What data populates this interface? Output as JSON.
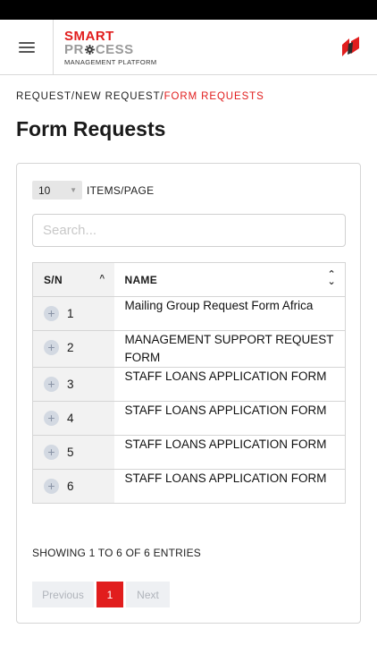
{
  "header": {
    "logo": {
      "line1": "SMART",
      "line2_part1": "PR",
      "line2_part2": "CESS",
      "line3": "MANAGEMENT PLATFORM"
    },
    "menu_icon": "hamburger-icon",
    "brand_icon": "company-logo"
  },
  "breadcrumb": {
    "part1": "REQUEST/",
    "part2": "NEW REQUEST/",
    "current": "FORM REQUESTS"
  },
  "page": {
    "title": "Form Requests"
  },
  "controls": {
    "page_size_value": "10",
    "page_size_label": "ITEMS/PAGE",
    "search_placeholder": "Search..."
  },
  "table": {
    "columns": [
      "S/N",
      "NAME"
    ],
    "rows": [
      {
        "sn": "1",
        "name": "Mailing Group Request Form Africa"
      },
      {
        "sn": "2",
        "name": "MANAGEMENT SUPPORT REQUEST FORM"
      },
      {
        "sn": "3",
        "name": "STAFF LOANS APPLICATION FORM"
      },
      {
        "sn": "4",
        "name": "STAFF LOANS APPLICATION FORM"
      },
      {
        "sn": "5",
        "name": "STAFF LOANS APPLICATION FORM"
      },
      {
        "sn": "6",
        "name": "STAFF LOANS APPLICATION FORM"
      }
    ]
  },
  "footer": {
    "showing": "SHOWING 1 TO 6 OF 6 ENTRIES",
    "prev": "Previous",
    "current_page": "1",
    "next": "Next"
  },
  "colors": {
    "accent": "#e11d1d",
    "muted": "#9a9a9a"
  }
}
